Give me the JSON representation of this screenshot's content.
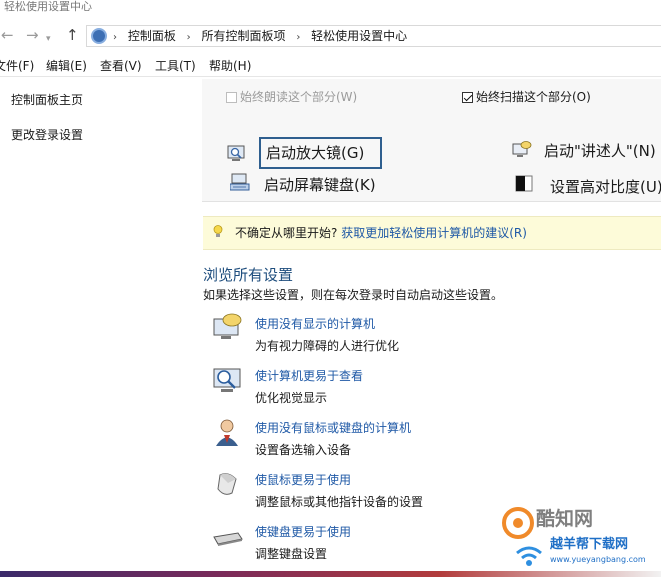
{
  "window": {
    "title": "轻松使用设置中心"
  },
  "nav": {
    "back_icon": "back-arrow-icon",
    "forward_icon": "forward-arrow-icon",
    "up_icon": "up-arrow-icon",
    "breadcrumbs": [
      "控制面板",
      "所有控制面板项",
      "轻松使用设置中心"
    ]
  },
  "menu": [
    "文件(F)",
    "编辑(E)",
    "查看(V)",
    "工具(T)",
    "帮助(H)"
  ],
  "sidebar": {
    "items": [
      "控制面板主页",
      "更改登录设置"
    ]
  },
  "quick": {
    "always_read_label": "始终朗读这个部分(W)",
    "always_read_checked": false,
    "always_scan_label": "始终扫描这个部分(O)",
    "always_scan_checked": true,
    "tools": [
      {
        "label": "启动放大镜(G)",
        "icon": "magnifier-icon"
      },
      {
        "label": "启动\"讲述人\"(N)",
        "icon": "narrator-icon"
      },
      {
        "label": "启动屏幕键盘(K)",
        "icon": "onscreen-keyboard-icon"
      },
      {
        "label": "设置高对比度(U)",
        "icon": "high-contrast-icon"
      }
    ]
  },
  "tip": {
    "prefix": "不确定从哪里开始?",
    "link": "获取更加轻松使用计算机的建议(R)"
  },
  "browse": {
    "title": "浏览所有设置",
    "description": "如果选择这些设置，则在每次登录时自动启动这些设置。",
    "entries": [
      {
        "link": "使用没有显示的计算机",
        "desc": "为有视力障碍的人进行优化",
        "icon": "speech-monitor-icon"
      },
      {
        "link": "使计算机更易于查看",
        "desc": "优化视觉显示",
        "icon": "magnify-monitor-icon"
      },
      {
        "link": "使用没有鼠标或键盘的计算机",
        "desc": "设置备选输入设备",
        "icon": "user-headset-icon"
      },
      {
        "link": "使鼠标更易于使用",
        "desc": "调整鼠标或其他指针设备的设置",
        "icon": "mouse-icon"
      },
      {
        "link": "使键盘更易于使用",
        "desc": "调整键盘设置",
        "icon": "keyboard-icon"
      }
    ]
  },
  "watermark": {
    "brand": "酷知网",
    "subtitle": "越羊帮下载网",
    "url": "www.yueyangbang.com"
  },
  "colors": {
    "link": "#1f59a6",
    "heading": "#1e4d7d",
    "tip_bg": "#fdfbd9",
    "focus": "#2f5f8f"
  }
}
